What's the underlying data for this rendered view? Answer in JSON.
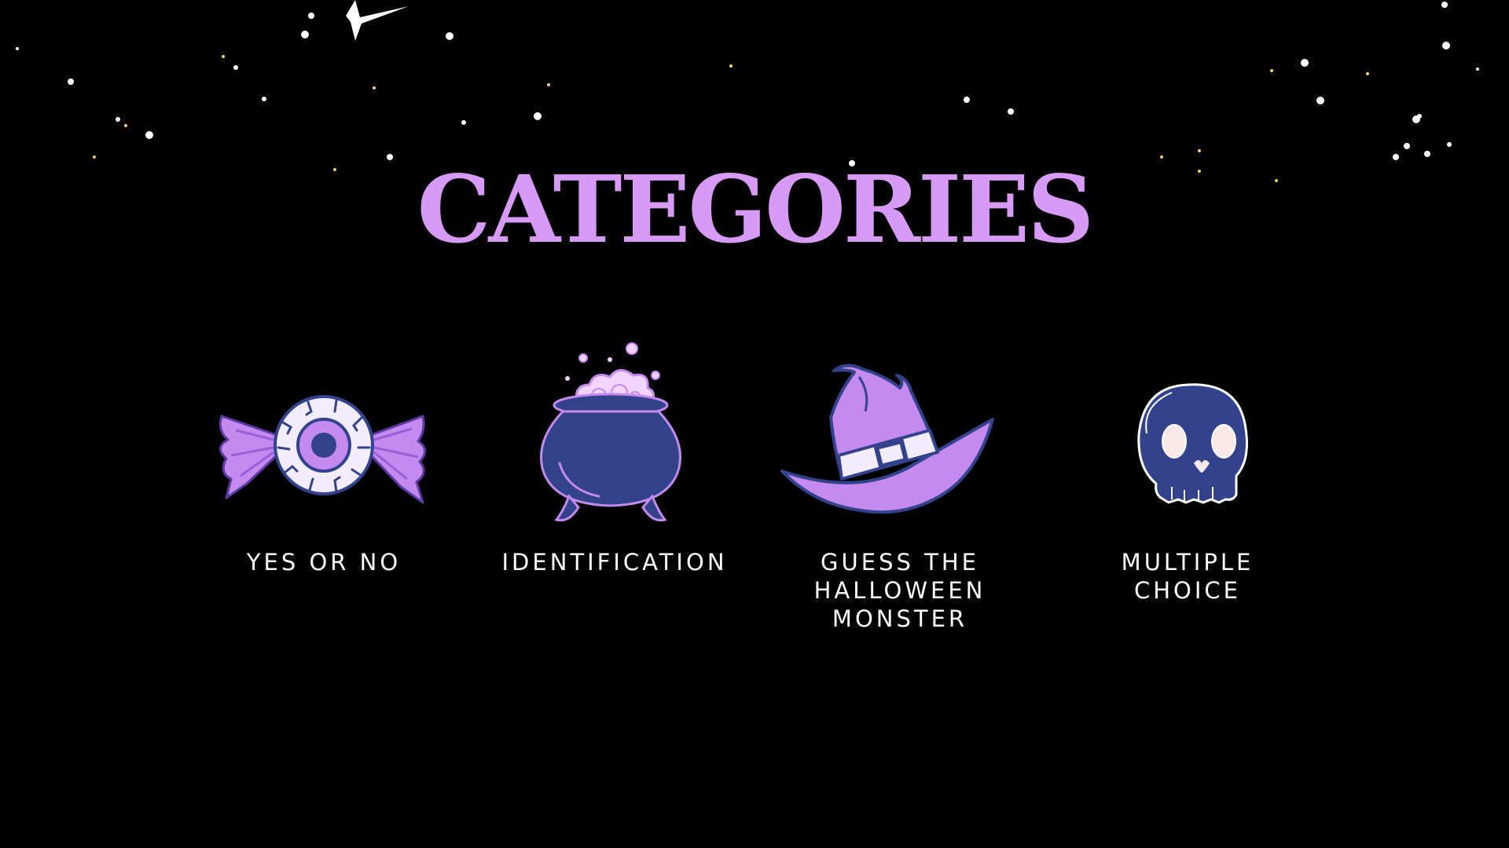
{
  "slide": {
    "title": "CATEGORIES",
    "colors": {
      "background": "#000000",
      "title": "#d89bf5",
      "label": "#ffffff",
      "accent_purple": "#c58af0",
      "accent_navy": "#33428c",
      "star": "#ffffff",
      "star_gold": "#f2cf7a"
    },
    "categories": [
      {
        "label": "YES OR NO",
        "icon": "eyeball-candy-icon"
      },
      {
        "label": "IDENTIFICATION",
        "icon": "cauldron-icon"
      },
      {
        "label": "GUESS THE\nHALLOWEEN\nMONSTER",
        "icon": "witch-hat-icon"
      },
      {
        "label": "MULTIPLE\nCHOICE",
        "icon": "skull-icon"
      }
    ]
  }
}
